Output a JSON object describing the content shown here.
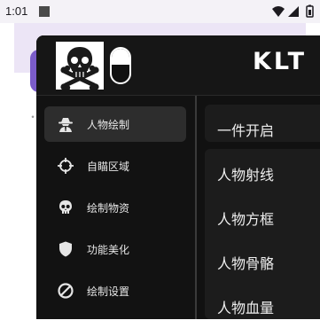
{
  "statusbar": {
    "time": "1:01",
    "icons": [
      "wifi-icon",
      "signal-icon",
      "battery-icon"
    ]
  },
  "menu": {
    "title": "KLT",
    "logo_icon": "skull-crossbones-icon",
    "toggle": {
      "state": "on"
    },
    "nav": [
      {
        "label": "人物绘制",
        "icon": "spy-icon",
        "active": true
      },
      {
        "label": "自瞄区域",
        "icon": "crosshair-icon",
        "active": false
      },
      {
        "label": "绘制物资",
        "icon": "skull-icon",
        "active": false
      },
      {
        "label": "功能美化",
        "icon": "shield-icon",
        "active": false
      },
      {
        "label": "绘制设置",
        "icon": "prohibited-icon",
        "active": false
      }
    ],
    "options": [
      {
        "label": "一件开启"
      },
      {
        "label": "人物射线"
      },
      {
        "label": "人物方框"
      },
      {
        "label": "人物骨骼"
      },
      {
        "label": "人物血量"
      }
    ]
  },
  "colors": {
    "panel_bg": "#111111",
    "active_item_bg": "#2d2d2d",
    "row_bg": "#1c1c1c",
    "text": "#eeeeee",
    "background_accent": "#7b5cc9"
  }
}
